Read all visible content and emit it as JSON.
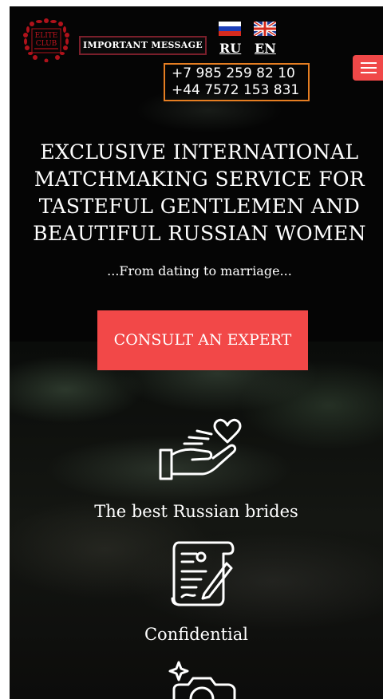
{
  "header": {
    "logo_alt": "ELITE CLUB",
    "logo_line1": "ELITE",
    "logo_line2": "CLUB",
    "important_label": "IMPORTANT MESSAGE",
    "languages": [
      {
        "code": "RU",
        "flag": "russia-flag-icon"
      },
      {
        "code": "EN",
        "flag": "uk-flag-icon"
      }
    ],
    "phones": [
      "+7 985 259 82 10",
      "+44 7572 153 831"
    ],
    "menu_icon": "hamburger-menu-icon"
  },
  "hero": {
    "headline_lines": [
      "EXCLUSIVE INTERNATIONAL",
      "MATCHMAKING SERVICE FOR",
      "TASTEFUL GENTLEMEN AND",
      "BEAUTIFUL RUSSIAN WOMEN"
    ],
    "subline": "...From dating to marriage...",
    "cta_label": "CONSULT AN EXPERT"
  },
  "features": [
    {
      "icon": "hand-heart-icon",
      "label": "The best Russian brides"
    },
    {
      "icon": "contract-signing-icon",
      "label": "Confidential"
    },
    {
      "icon": "camera-sparkle-icon",
      "label": ""
    }
  ],
  "colors": {
    "accent": "#f24848",
    "important_border": "#7a1f2b",
    "phone_border": "#e67e22",
    "background": "#050505"
  }
}
